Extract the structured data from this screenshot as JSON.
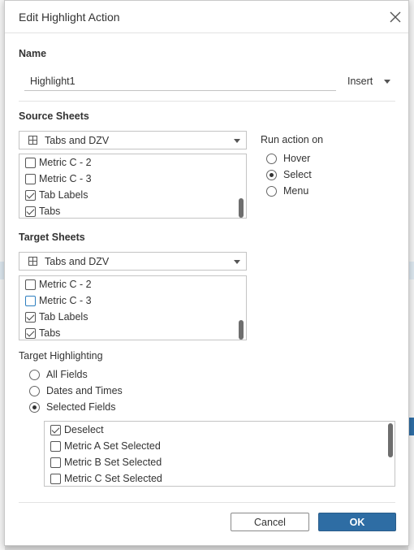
{
  "dialog": {
    "title": "Edit Highlight Action",
    "close_icon": "close-icon"
  },
  "name_section": {
    "label": "Name",
    "value": "Highlight1",
    "insert_label": "Insert"
  },
  "source_sheets": {
    "label": "Source Sheets",
    "selected": "Tabs and DZV",
    "items": [
      {
        "label": "Metric C - 2",
        "checked": false
      },
      {
        "label": "Metric C - 3",
        "checked": false
      },
      {
        "label": "Tab Labels",
        "checked": true
      },
      {
        "label": "Tabs",
        "checked": true
      }
    ]
  },
  "run_action_on": {
    "label": "Run action on",
    "options": [
      {
        "label": "Hover",
        "selected": false
      },
      {
        "label": "Select",
        "selected": true
      },
      {
        "label": "Menu",
        "selected": false
      }
    ]
  },
  "target_sheets": {
    "label": "Target Sheets",
    "selected": "Tabs and DZV",
    "items": [
      {
        "label": "Metric C - 2",
        "checked": false
      },
      {
        "label": "Metric C - 3",
        "checked": false
      },
      {
        "label": "Tab Labels",
        "checked": true
      },
      {
        "label": "Tabs",
        "checked": true
      }
    ]
  },
  "target_highlighting": {
    "label": "Target Highlighting",
    "options": [
      {
        "label": "All Fields",
        "selected": false
      },
      {
        "label": "Dates and Times",
        "selected": false
      },
      {
        "label": "Selected Fields",
        "selected": true
      }
    ],
    "fields": [
      {
        "label": "Deselect",
        "checked": true
      },
      {
        "label": "Metric A Set Selected",
        "checked": false
      },
      {
        "label": "Metric B Set Selected",
        "checked": false
      },
      {
        "label": "Metric C Set Selected",
        "checked": false
      }
    ]
  },
  "footer": {
    "cancel_label": "Cancel",
    "ok_label": "OK"
  },
  "colors": {
    "primary": "#2e6da4",
    "focus": "#2e7fbf"
  }
}
